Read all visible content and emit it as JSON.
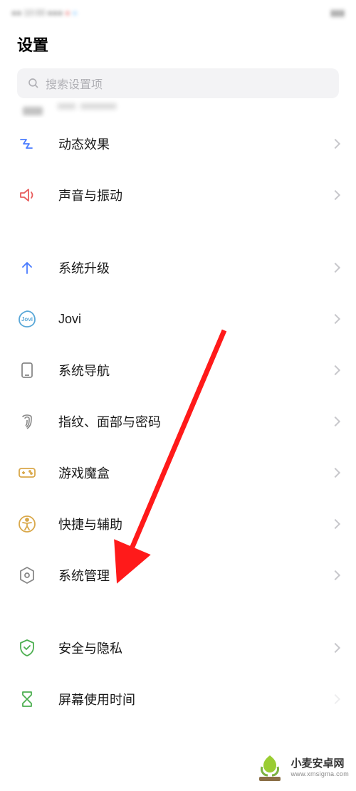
{
  "title": "设置",
  "search": {
    "placeholder": "搜索设置项"
  },
  "items": {
    "dynamic_effects": "动态效果",
    "sound_vibration": "声音与振动",
    "system_upgrade": "系统升级",
    "jovi": "Jovi",
    "system_navigation": "系统导航",
    "fingerprint_face_password": "指纹、面部与密码",
    "game_box": "游戏魔盒",
    "shortcut_accessibility": "快捷与辅助",
    "system_management": "系统管理",
    "security_privacy": "安全与隐私",
    "screen_time": "屏幕使用时间"
  },
  "watermark": {
    "cn": "小麦安卓网",
    "en": "www.xmsigma.com"
  }
}
